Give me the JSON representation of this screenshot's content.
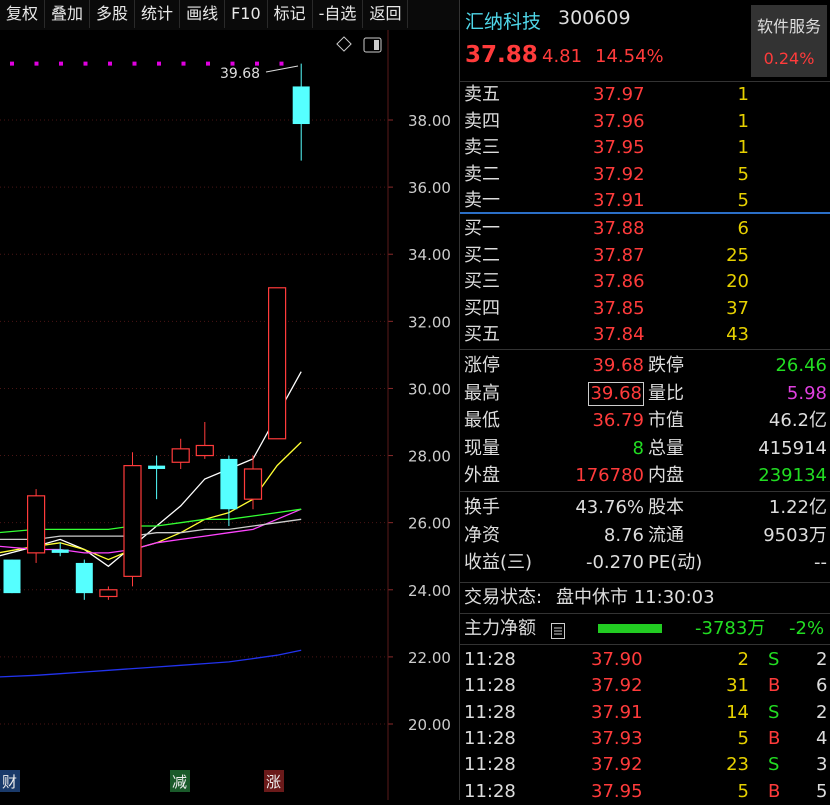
{
  "toolbar": {
    "buttons": [
      "复权",
      "叠加",
      "多股",
      "统计",
      "画线",
      "F10",
      "标记",
      "-自选",
      "返回"
    ]
  },
  "chart": {
    "high_label": "39.68",
    "y_ticks": [
      "38.00",
      "36.00",
      "34.00",
      "32.00",
      "30.00",
      "28.00",
      "26.00",
      "24.00",
      "22.00",
      "20.00"
    ],
    "markers": [
      {
        "text": "财",
        "color": "#1a3a6a"
      },
      {
        "text": "减",
        "color": "#1a5a2a"
      },
      {
        "text": "涨",
        "color": "#6a1a1a"
      }
    ]
  },
  "chart_data": {
    "type": "candlestick",
    "ylim": [
      19.5,
      40.0
    ],
    "candles": [
      {
        "o": 24.9,
        "h": 24.9,
        "l": 23.9,
        "c": 23.9
      },
      {
        "o": 25.1,
        "h": 27.0,
        "l": 24.8,
        "c": 26.8
      },
      {
        "o": 25.2,
        "h": 25.4,
        "l": 25.0,
        "c": 25.1
      },
      {
        "o": 24.8,
        "h": 24.9,
        "l": 23.7,
        "c": 23.9
      },
      {
        "o": 23.8,
        "h": 24.1,
        "l": 23.7,
        "c": 24.0
      },
      {
        "o": 24.4,
        "h": 28.1,
        "l": 24.1,
        "c": 27.7
      },
      {
        "o": 27.7,
        "h": 28.0,
        "l": 26.7,
        "c": 27.6
      },
      {
        "o": 27.8,
        "h": 28.5,
        "l": 27.6,
        "c": 28.2
      },
      {
        "o": 28.0,
        "h": 29.0,
        "l": 27.9,
        "c": 28.3
      },
      {
        "o": 27.9,
        "h": 28.0,
        "l": 25.9,
        "c": 26.4
      },
      {
        "o": 26.7,
        "h": 28.0,
        "l": 26.4,
        "c": 27.6
      },
      {
        "o": 28.5,
        "h": 33.0,
        "l": 28.5,
        "c": 33.0
      },
      {
        "o": 39.0,
        "h": 39.68,
        "l": 36.79,
        "c": 37.88
      }
    ],
    "ma_series": [
      {
        "color": "#ffffff",
        "values": [
          25.0,
          25.3,
          25.5,
          25.2,
          24.7,
          25.3,
          25.9,
          26.5,
          27.3,
          27.6,
          27.9,
          29.2,
          30.5
        ]
      },
      {
        "color": "#ffff33",
        "values": [
          25.1,
          25.3,
          25.4,
          25.2,
          24.9,
          25.2,
          25.4,
          25.7,
          26.1,
          26.3,
          26.7,
          27.7,
          28.4
        ]
      },
      {
        "color": "#ff44ff",
        "values": [
          25.3,
          25.2,
          25.2,
          25.1,
          25.1,
          25.2,
          25.4,
          25.5,
          25.6,
          25.7,
          25.8,
          26.1,
          26.4
        ]
      },
      {
        "color": "#33ff33",
        "values": [
          25.7,
          25.8,
          25.8,
          25.8,
          25.8,
          25.9,
          25.9,
          26.0,
          26.1,
          26.1,
          26.2,
          26.3,
          26.4
        ]
      },
      {
        "color": "#cccccc",
        "values": [
          25.5,
          25.5,
          25.6,
          25.6,
          25.6,
          25.6,
          25.7,
          25.7,
          25.8,
          25.8,
          25.9,
          26.0,
          26.1
        ]
      },
      {
        "color": "#2233ee",
        "values": [
          21.4,
          21.45,
          21.5,
          21.55,
          21.6,
          21.65,
          21.7,
          21.75,
          21.8,
          21.85,
          21.95,
          22.05,
          22.2
        ]
      }
    ]
  },
  "stock": {
    "name": "汇纳科技",
    "code": "300609",
    "price": "37.88",
    "change": "4.81",
    "change_pct": "14.54%",
    "service_title": "软件服务",
    "service_pct": "0.24%"
  },
  "orderbook": {
    "sell": [
      {
        "label": "卖五",
        "price": "37.97",
        "vol": "1"
      },
      {
        "label": "卖四",
        "price": "37.96",
        "vol": "1"
      },
      {
        "label": "卖三",
        "price": "37.95",
        "vol": "1"
      },
      {
        "label": "卖二",
        "price": "37.92",
        "vol": "5"
      },
      {
        "label": "卖一",
        "price": "37.91",
        "vol": "5"
      }
    ],
    "buy": [
      {
        "label": "买一",
        "price": "37.88",
        "vol": "6"
      },
      {
        "label": "买二",
        "price": "37.87",
        "vol": "25"
      },
      {
        "label": "买三",
        "price": "37.86",
        "vol": "20"
      },
      {
        "label": "买四",
        "price": "37.85",
        "vol": "37"
      },
      {
        "label": "买五",
        "price": "37.84",
        "vol": "43"
      }
    ]
  },
  "stats": {
    "rows": [
      {
        "l1": "涨停",
        "v1": "39.68",
        "c1": "red",
        "l2": "跌停",
        "v2": "26.46",
        "c2": "green"
      },
      {
        "l1": "最高",
        "v1": "39.68",
        "c1": "red",
        "l2": "量比",
        "v2": "5.98",
        "c2": "purple"
      },
      {
        "l1": "最低",
        "v1": "36.79",
        "c1": "red",
        "l2": "市值",
        "v2": "46.2亿",
        "c2": "lbl"
      },
      {
        "l1": "现量",
        "v1": "8",
        "c1": "green",
        "l2": "总量",
        "v2": "415914",
        "c2": "lbl"
      },
      {
        "l1": "外盘",
        "v1": "176780",
        "c1": "red",
        "l2": "内盘",
        "v2": "239134",
        "c2": "green"
      }
    ],
    "rows2": [
      {
        "l1": "换手",
        "v1": "43.76%",
        "l2": "股本",
        "v2": "1.22亿"
      },
      {
        "l1": "净资",
        "v1": "8.76",
        "l2": "流通",
        "v2": "9503万"
      },
      {
        "l1": "收益(三)",
        "v1": "-0.270",
        "l2": "PE(动)",
        "v2": "--"
      }
    ]
  },
  "status": {
    "label": "交易状态:",
    "value": "盘中休市 11:30:03"
  },
  "netflow": {
    "label": "主力净额",
    "amount": "-3783万",
    "pct": "-2%",
    "bar_color": "#22cc22"
  },
  "ticks": [
    {
      "time": "11:28",
      "price": "37.90",
      "vol": "2",
      "side": "S",
      "n": "2"
    },
    {
      "time": "11:28",
      "price": "37.92",
      "vol": "31",
      "side": "B",
      "n": "6"
    },
    {
      "time": "11:28",
      "price": "37.91",
      "vol": "14",
      "side": "S",
      "n": "2"
    },
    {
      "time": "11:28",
      "price": "37.93",
      "vol": "5",
      "side": "B",
      "n": "4"
    },
    {
      "time": "11:28",
      "price": "37.92",
      "vol": "23",
      "side": "S",
      "n": "3"
    },
    {
      "time": "11:28",
      "price": "37.95",
      "vol": "5",
      "side": "B",
      "n": "5"
    }
  ]
}
